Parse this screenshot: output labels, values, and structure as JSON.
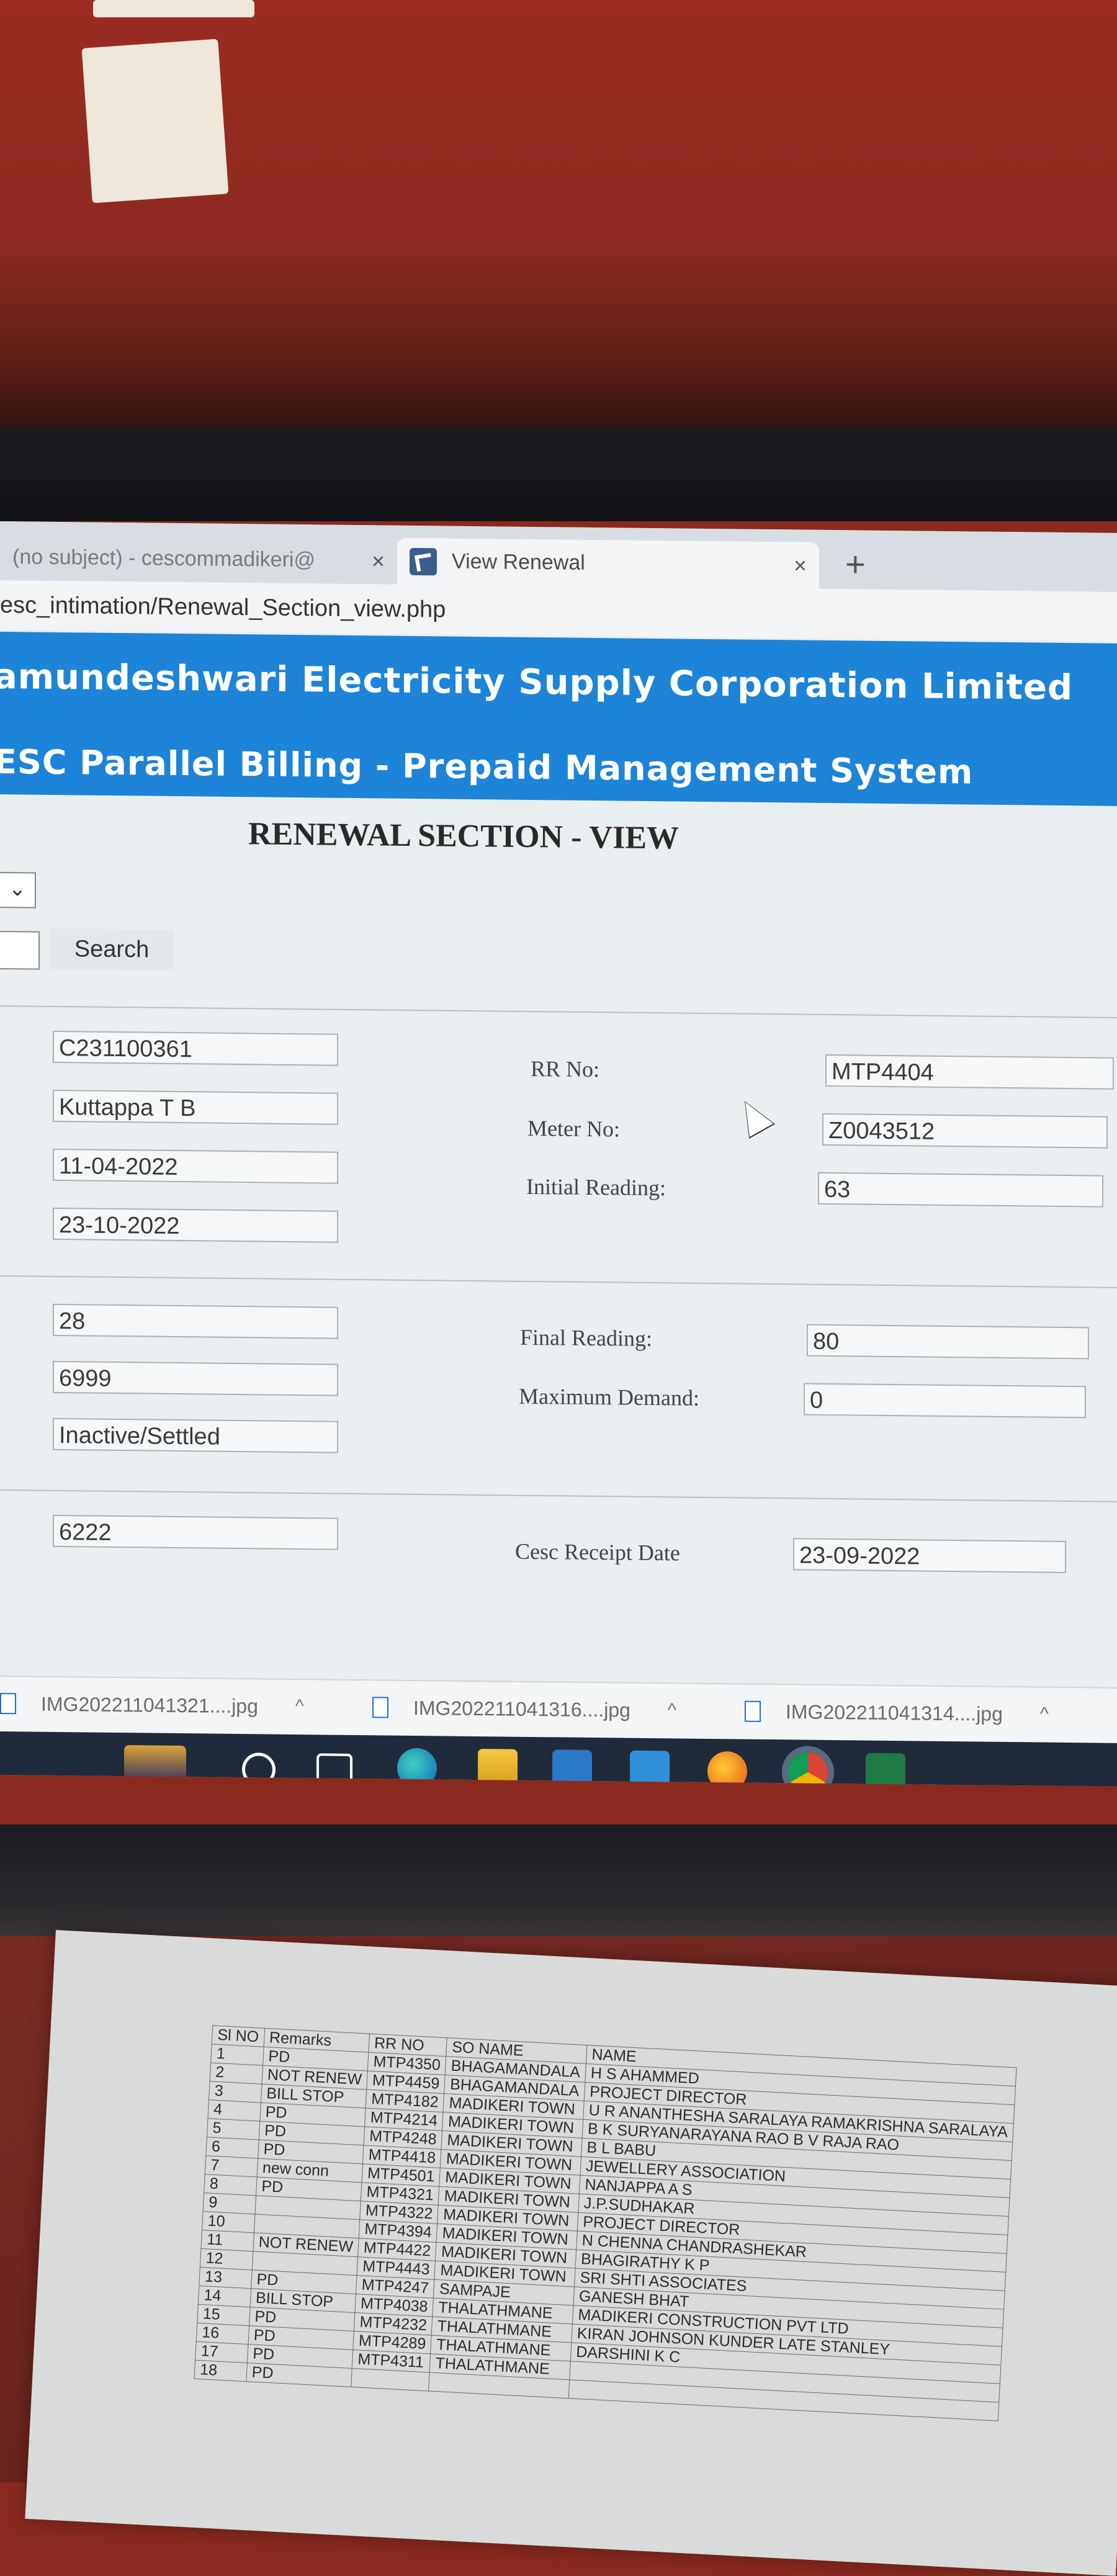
{
  "browser": {
    "tabs": [
      {
        "label": "(no subject) - cescommadikeri@",
        "close": "×"
      },
      {
        "label": "View Renewal",
        "close": "×"
      }
    ],
    "new_tab": "+",
    "address": "esc_intimation/Renewal_Section_view.php"
  },
  "header": {
    "title": "amundeshwari Electricity Supply Corporation Limited",
    "subtitle": "ESC Parallel Billing - Prepaid Management System"
  },
  "page": {
    "heading": "RENEWAL SECTION - VIEW",
    "select_chevron": "⌄",
    "search_label": "Search"
  },
  "form": {
    "left_values": [
      "C231100361",
      "Kuttappa T B",
      "11-04-2022",
      "23-10-2022"
    ],
    "rr_no_label": "RR No:",
    "rr_no": "MTP4404",
    "meter_no_label": "Meter No:",
    "meter_no": "Z0043512",
    "initial_reading_label": "Initial Reading:",
    "initial_reading": "63",
    "mid_values": [
      "28",
      "6999",
      "Inactive/Settled"
    ],
    "final_reading_label": "Final Reading:",
    "final_reading": "80",
    "max_demand_label": "Maximum Demand:",
    "max_demand": "0",
    "receipt_no": "6222",
    "receipt_date_label": "Cesc Receipt Date",
    "receipt_date": "23-09-2022"
  },
  "downloads": [
    {
      "name": "IMG202211041321....jpg",
      "chevron": "^"
    },
    {
      "name": "IMG202211041316....jpg",
      "chevron": "^"
    },
    {
      "name": "IMG202211041314....jpg",
      "chevron": "^"
    }
  ],
  "printout": {
    "headers": [
      "Sl NO",
      "Remarks",
      "RR NO",
      "SO NAME",
      "NAME"
    ],
    "rows": [
      [
        "1",
        "PD",
        "MTP4350",
        "BHAGAMANDALA",
        "H S AHAMMED"
      ],
      [
        "2",
        "NOT RENEW",
        "MTP4459",
        "BHAGAMANDALA",
        "PROJECT DIRECTOR"
      ],
      [
        "3",
        "BILL STOP",
        "MTP4182",
        "MADIKERI TOWN",
        "U R ANANTHESHA SARALAYA RAMAKRISHNA SARALAYA"
      ],
      [
        "4",
        "PD",
        "MTP4214",
        "MADIKERI TOWN",
        "B K SURYANARAYANA RAO B V RAJA RAO"
      ],
      [
        "5",
        "PD",
        "MTP4248",
        "MADIKERI TOWN",
        "B L BABU"
      ],
      [
        "6",
        "PD",
        "MTP4418",
        "MADIKERI TOWN",
        "JEWELLERY ASSOCIATION"
      ],
      [
        "7",
        "new conn",
        "MTP4501",
        "MADIKERI TOWN",
        "NANJAPPA A S"
      ],
      [
        "8",
        "PD",
        "MTP4321",
        "MADIKERI TOWN",
        "J.P.SUDHAKAR"
      ],
      [
        "9",
        "",
        "MTP4322",
        "MADIKERI TOWN",
        "PROJECT DIRECTOR"
      ],
      [
        "10",
        "",
        "MTP4394",
        "MADIKERI TOWN",
        "N CHENNA CHANDRASHEKAR"
      ],
      [
        "11",
        "NOT RENEW",
        "MTP4422",
        "MADIKERI TOWN",
        "BHAGIRATHY K P"
      ],
      [
        "12",
        "",
        "MTP4443",
        "MADIKERI TOWN",
        "SRI SHTI ASSOCIATES"
      ],
      [
        "13",
        "PD",
        "MTP4247",
        "SAMPAJE",
        "GANESH BHAT"
      ],
      [
        "14",
        "BILL STOP",
        "MTP4038",
        "THALATHMANE",
        "MADIKERI CONSTRUCTION PVT LTD"
      ],
      [
        "15",
        "PD",
        "MTP4232",
        "THALATHMANE",
        "KIRAN JOHNSON KUNDER LATE STANLEY"
      ],
      [
        "16",
        "PD",
        "MTP4289",
        "THALATHMANE",
        "DARSHINI K C"
      ],
      [
        "17",
        "PD",
        "MTP4311",
        "THALATHMANE",
        ""
      ],
      [
        "18",
        "PD",
        "",
        "",
        ""
      ]
    ]
  }
}
